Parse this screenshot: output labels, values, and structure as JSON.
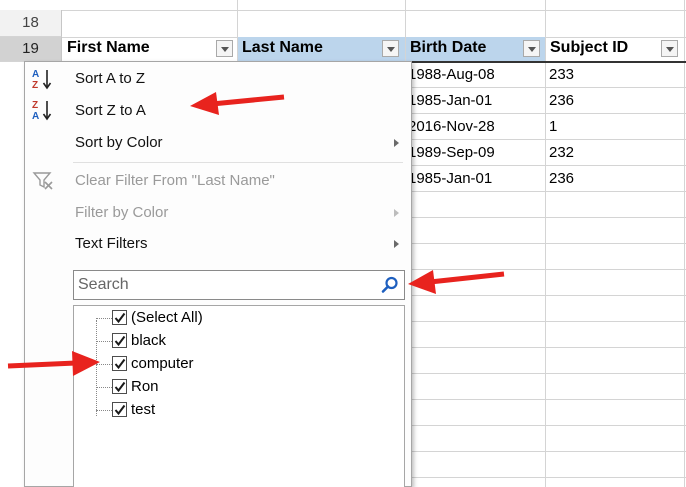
{
  "sheet": {
    "row_numbers": [
      "18",
      "19"
    ],
    "headers": [
      {
        "label": "First Name",
        "active": false
      },
      {
        "label": "Last Name",
        "active": true
      },
      {
        "label": "Birth Date",
        "active": true
      },
      {
        "label": "Subject ID",
        "active": false
      }
    ],
    "birth_dates": [
      "1988-Aug-08",
      "1985-Jan-01",
      "2016-Nov-28",
      "1989-Sep-09",
      "1985-Jan-01"
    ],
    "subject_ids": [
      "233",
      "236",
      "1",
      "232",
      "236"
    ]
  },
  "menu": {
    "sort_a_to_z": "Sort A to Z",
    "sort_z_to_a": "Sort Z to A",
    "sort_by_color": "Sort by Color",
    "clear_filter": "Clear Filter From \"Last Name\"",
    "filter_by_color": "Filter by Color",
    "text_filters": "Text Filters",
    "search_placeholder": "Search",
    "list_items": [
      "(Select All)",
      "black",
      "computer",
      "Ron",
      "test"
    ]
  },
  "icons": {
    "sort_az": "sort-ascending-icon",
    "sort_za": "sort-descending-icon",
    "clear_filter": "clear-filter-icon",
    "search": "magnifier-icon",
    "checkbox": "checkmark-icon"
  },
  "colors": {
    "accent_header": "#bcd5ec",
    "arrow_red": "#e8231e",
    "icon_blue": "#1e5fbf"
  }
}
